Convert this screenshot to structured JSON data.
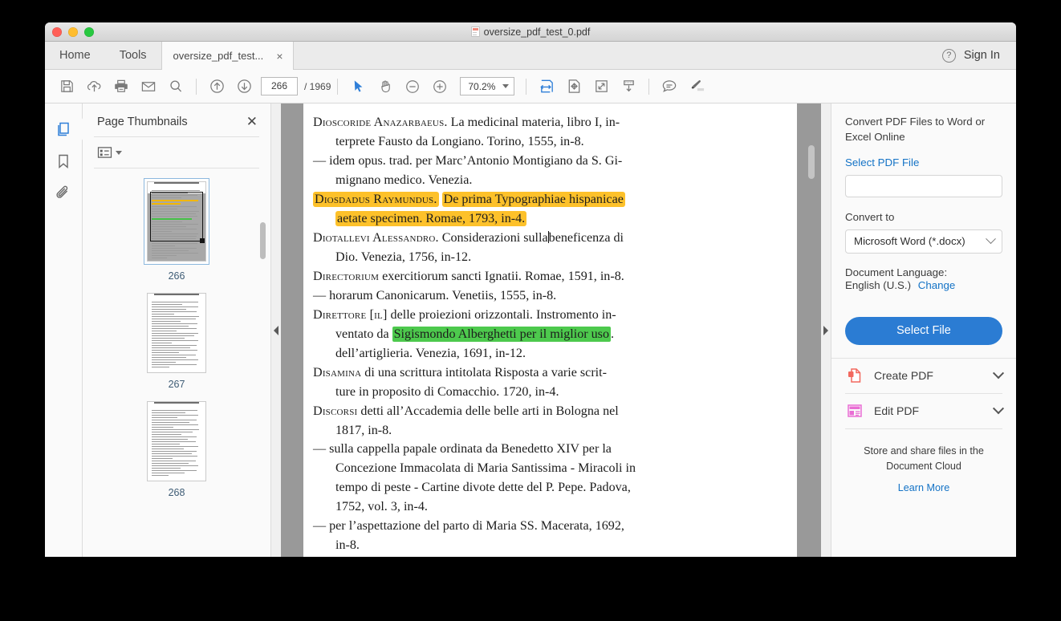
{
  "window": {
    "title": "oversize_pdf_test_0.pdf"
  },
  "tabs": {
    "home_label": "Home",
    "tools_label": "Tools",
    "active_tab_label": "oversize_pdf_test...",
    "close_glyph": "×",
    "help_glyph": "?",
    "signin_label": "Sign In"
  },
  "toolbar": {
    "icons_left": [
      "save-icon",
      "upload-cloud-icon",
      "print-icon",
      "email-icon",
      "search-icon"
    ],
    "page_prev": "previous-page-icon",
    "page_next": "next-page-icon",
    "page_current": "266",
    "page_total": "/ 1969",
    "tools": [
      "select-cursor-icon",
      "hand-tool-icon",
      "zoom-out-icon",
      "zoom-in-icon"
    ],
    "zoom_value": "70.2%",
    "icons_right": [
      "fit-width-icon",
      "pan-page-icon",
      "fit-page-icon",
      "scroll-mode-icon",
      "comment-icon",
      "highlight-icon"
    ]
  },
  "rail": {
    "items": [
      "page-thumbnails-icon",
      "bookmarks-icon",
      "attachments-icon"
    ]
  },
  "thumbnails": {
    "title": "Page Thumbnails",
    "close_glyph": "✕",
    "options_icon": "list-options-icon",
    "pages": [
      {
        "label": "266",
        "selected": true
      },
      {
        "label": "267",
        "selected": false
      },
      {
        "label": "268",
        "selected": false
      }
    ]
  },
  "document": {
    "lines": [
      {
        "indent": false,
        "segments": [
          {
            "text": "Dioscoride Anazarbaeus.",
            "style": "smallcaps"
          },
          {
            "text": " La medicinal materia, libro I, in-",
            "style": "normal"
          }
        ]
      },
      {
        "indent": true,
        "segments": [
          {
            "text": "terprete Fausto da Longiano. Torino, 1555, in-8.",
            "style": "normal"
          }
        ]
      },
      {
        "indent": false,
        "segments": [
          {
            "text": "— idem opus. trad. per Marc’Antonio Montigiano da S. Gi-",
            "style": "normal"
          }
        ]
      },
      {
        "indent": true,
        "segments": [
          {
            "text": "mignano medico. Venezia.",
            "style": "normal"
          }
        ]
      },
      {
        "indent": false,
        "segments": [
          {
            "text": "Diosdadus Raymundus.",
            "style": "smallcaps-highlight-yellow"
          },
          {
            "text": " ",
            "style": "normal"
          },
          {
            "text": "De prima Typographiae hispanicae",
            "style": "highlight-yellow"
          }
        ]
      },
      {
        "indent": true,
        "segments": [
          {
            "text": "aetate specimen. Romae, 1793, in-4.",
            "style": "highlight-yellow"
          }
        ]
      },
      {
        "indent": false,
        "segments": [
          {
            "text": "Diotallevi Alessandro.",
            "style": "smallcaps"
          },
          {
            "text": " Considerazioni sulla",
            "style": "normal"
          },
          {
            "text": "|",
            "style": "caret"
          },
          {
            "text": "beneficenza di",
            "style": "normal"
          }
        ]
      },
      {
        "indent": true,
        "segments": [
          {
            "text": "Dio. Venezia, 1756, in-12.",
            "style": "normal"
          }
        ]
      },
      {
        "indent": false,
        "segments": [
          {
            "text": "Directorium",
            "style": "smallcaps"
          },
          {
            "text": " exercitiorum sancti Ignatii. Romae, 1591, in-8.",
            "style": "normal"
          }
        ]
      },
      {
        "indent": false,
        "segments": [
          {
            "text": "— horarum Canonicarum. Venetiis, 1555, in-8.",
            "style": "normal"
          }
        ]
      },
      {
        "indent": false,
        "segments": [
          {
            "text": "Direttore [il]",
            "style": "smallcaps"
          },
          {
            "text": " delle proiezioni orizzontali. Instromento in-",
            "style": "normal"
          }
        ]
      },
      {
        "indent": true,
        "segments": [
          {
            "text": "ventato da ",
            "style": "normal"
          },
          {
            "text": "Sigismondo Alberghetti per il miglior uso",
            "style": "highlight-green"
          },
          {
            "text": ".",
            "style": "normal"
          }
        ]
      },
      {
        "indent": true,
        "segments": [
          {
            "text": "dell’artiglieria. Venezia, 1691, in-12.",
            "style": "normal"
          }
        ]
      },
      {
        "indent": false,
        "segments": [
          {
            "text": "Disamina",
            "style": "smallcaps"
          },
          {
            "text": " di una scrittura intitolata Risposta a varie scrit-",
            "style": "normal"
          }
        ]
      },
      {
        "indent": true,
        "segments": [
          {
            "text": "ture in proposito di Comacchio. 1720, in-4.",
            "style": "normal"
          }
        ]
      },
      {
        "indent": false,
        "segments": [
          {
            "text": "Discorsi",
            "style": "smallcaps"
          },
          {
            "text": " detti all’Accademia delle belle arti in Bologna nel",
            "style": "normal"
          }
        ]
      },
      {
        "indent": true,
        "segments": [
          {
            "text": "1817, in-8.",
            "style": "normal"
          }
        ]
      },
      {
        "indent": false,
        "segments": [
          {
            "text": "— sulla cappella papale ordinata da Benedetto XIV per la",
            "style": "normal"
          }
        ]
      },
      {
        "indent": true,
        "segments": [
          {
            "text": "Concezione Immacolata di Maria Santissima - Miracoli in",
            "style": "normal"
          }
        ]
      },
      {
        "indent": true,
        "segments": [
          {
            "text": "tempo di peste - Cartine divote dette del P. Pepe. Padova,",
            "style": "normal"
          }
        ]
      },
      {
        "indent": true,
        "segments": [
          {
            "text": "1752, vol. 3, in-4.",
            "style": "normal"
          }
        ]
      },
      {
        "indent": false,
        "segments": [
          {
            "text": "— per l’aspettazione del parto di Maria SS. Macerata, 1692,",
            "style": "normal"
          }
        ]
      },
      {
        "indent": true,
        "segments": [
          {
            "text": "in-8.",
            "style": "normal"
          }
        ]
      }
    ]
  },
  "tools_panel": {
    "heading": "Convert PDF Files to Word or Excel Online",
    "select_pdf_link": "Select PDF File",
    "file_input_value": "",
    "file_input_placeholder": "",
    "convert_to_label": "Convert to",
    "convert_to_value": "Microsoft Word (*.docx)",
    "doc_language_label": "Document Language:",
    "doc_language_value": "English (U.S.)",
    "change_link": "Change",
    "select_file_button": "Select File",
    "rows": [
      {
        "label": "Create PDF",
        "icon": "create-pdf-icon"
      },
      {
        "label": "Edit PDF",
        "icon": "edit-pdf-icon"
      }
    ],
    "store_text": "Store and share files in the Document Cloud",
    "learn_more": "Learn More"
  },
  "colors": {
    "accent_blue": "#2b7cd3",
    "link_blue": "#1473c6",
    "highlight_yellow": "#fdc12a",
    "highlight_green": "#4dc94d",
    "viewport_gray": "#999999"
  }
}
